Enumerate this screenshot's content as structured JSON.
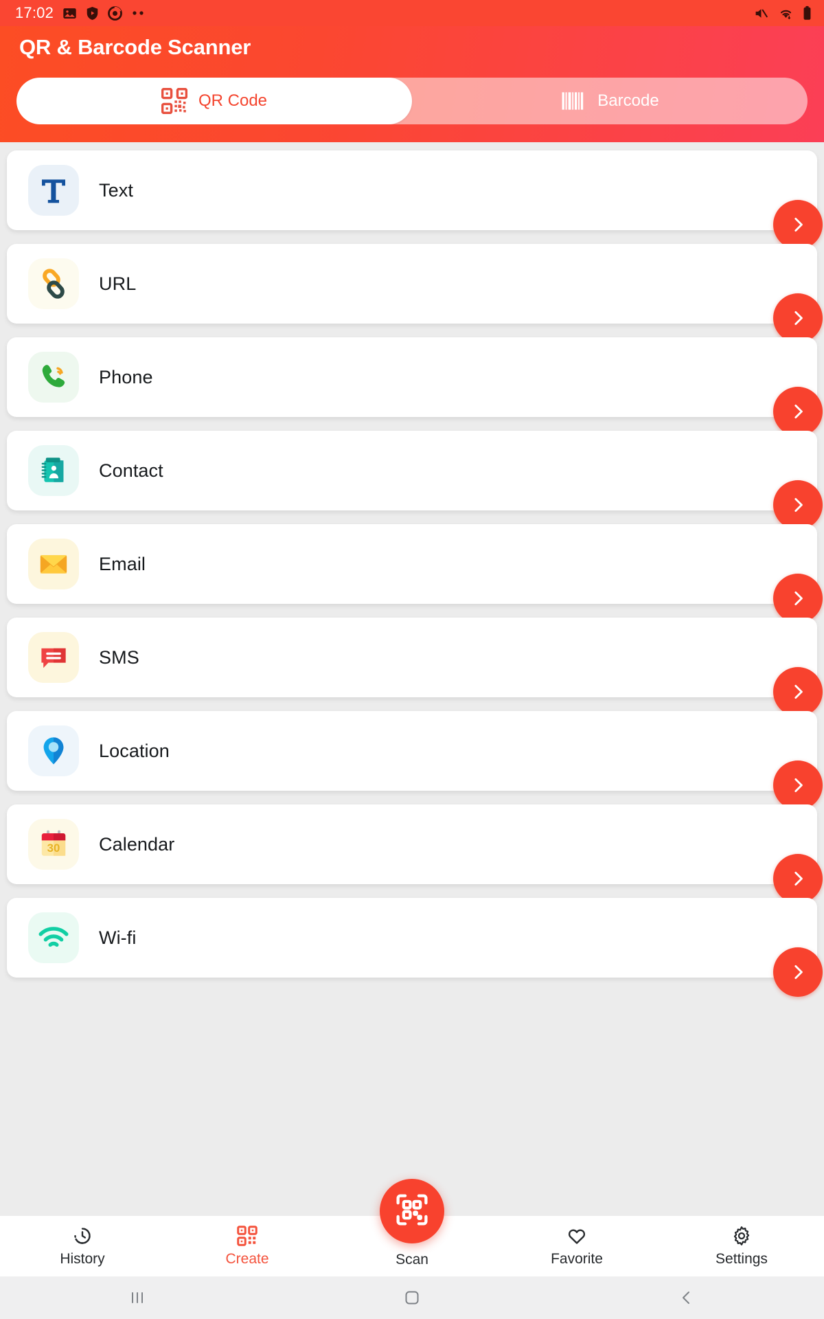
{
  "status_bar": {
    "time": "17:02",
    "left_icons": [
      "image-icon",
      "shield-icon",
      "alarm-icon",
      "more-dots-icon"
    ],
    "right_icons": [
      "mute-icon",
      "wifi-icon",
      "battery-icon"
    ]
  },
  "header": {
    "title": "QR & Barcode Scanner",
    "brand_color": "#fb4730",
    "tabs": [
      {
        "label": "QR Code",
        "icon": "qr-code-icon",
        "active": true
      },
      {
        "label": "Barcode",
        "icon": "barcode-icon",
        "active": false
      }
    ]
  },
  "list": {
    "items": [
      {
        "label": "Text",
        "icon": "text-icon",
        "chevron": "chevron-right-icon"
      },
      {
        "label": "URL",
        "icon": "link-icon",
        "chevron": "chevron-right-icon"
      },
      {
        "label": "Phone",
        "icon": "phone-icon",
        "chevron": "chevron-right-icon"
      },
      {
        "label": "Contact",
        "icon": "contact-icon",
        "chevron": "chevron-right-icon"
      },
      {
        "label": "Email",
        "icon": "email-icon",
        "chevron": "chevron-right-icon"
      },
      {
        "label": "SMS",
        "icon": "sms-icon",
        "chevron": "chevron-right-icon"
      },
      {
        "label": "Location",
        "icon": "location-icon",
        "chevron": "chevron-right-icon"
      },
      {
        "label": "Calendar",
        "icon": "calendar-icon",
        "chevron": "chevron-right-icon"
      },
      {
        "label": "Wi-fi",
        "icon": "wifi-signal-icon",
        "chevron": "chevron-right-icon"
      }
    ]
  },
  "bottom_nav": {
    "accent_color": "#f4523c",
    "items": [
      {
        "label": "History",
        "icon": "clock-icon",
        "active": false
      },
      {
        "label": "Create",
        "icon": "qr-code-icon",
        "active": true
      },
      {
        "label": "Scan",
        "icon": "qr-scan-icon",
        "active": false
      },
      {
        "label": "Favorite",
        "icon": "heart-icon",
        "active": false
      },
      {
        "label": "Settings",
        "icon": "gear-icon",
        "active": false
      }
    ]
  },
  "system_nav": {
    "buttons": [
      {
        "name": "recents-icon",
        "glyph": "|||"
      },
      {
        "name": "home-icon",
        "glyph": "▢"
      },
      {
        "name": "back-icon",
        "glyph": "‹"
      }
    ]
  }
}
